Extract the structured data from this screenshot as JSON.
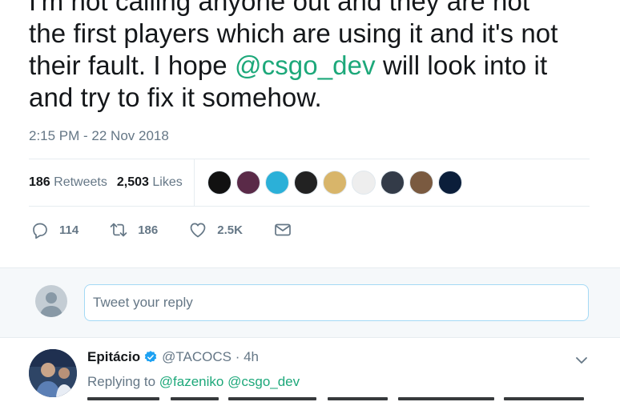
{
  "tweet": {
    "text_line1": "I'm not calling anyone out and they are not",
    "text_line2": "the first players which are using it and it's not",
    "text_line3_pre": "their fault. I hope ",
    "text_line3_mention": "@csgo_dev",
    "text_line3_post": " will look into it",
    "text_line4": "and try to fix it somehow.",
    "timestamp": "2:15 PM - 22 Nov 2018"
  },
  "stats": {
    "retweets_count": "186",
    "retweets_label": "Retweets",
    "likes_count": "2,503",
    "likes_label": "Likes"
  },
  "liker_avatars": [
    {
      "color": "#111111"
    },
    {
      "color": "#5a2a48"
    },
    {
      "color": "#2bb0d8"
    },
    {
      "color": "#222222"
    },
    {
      "color": "#d8b56a"
    },
    {
      "color": "#eeeeee"
    },
    {
      "color": "#333b48"
    },
    {
      "color": "#7a5a40"
    },
    {
      "color": "#0b1e3a"
    }
  ],
  "actions": {
    "reply_count": "114",
    "retweet_count": "186",
    "like_count": "2.5K"
  },
  "reply_composer": {
    "placeholder": "Tweet your reply"
  },
  "reply_tweet": {
    "name": "Epitácio",
    "handle": "@TACOCS",
    "time": "· 4h",
    "replying_label": "Replying to",
    "mention_1": "@fazeniko",
    "mention_2": "@csgo_dev"
  },
  "colors": {
    "mention": "#1da87a",
    "muted": "#657786",
    "text": "#14171a",
    "verified": "#1da1f2",
    "reply_bg": "#f5f8fa"
  }
}
